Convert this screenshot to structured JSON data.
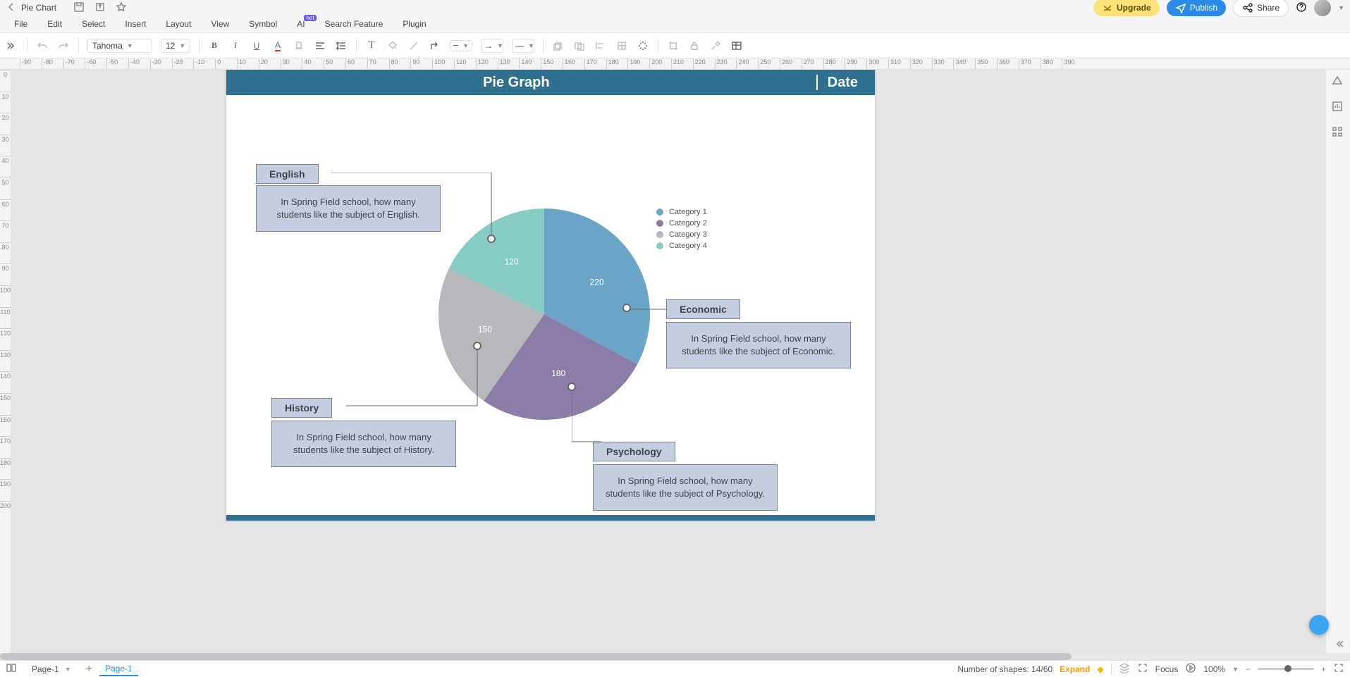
{
  "titlebar": {
    "doc_title": "Pie Chart",
    "upgrade": "Upgrade",
    "publish": "Publish",
    "share": "Share"
  },
  "menubar": [
    "File",
    "Edit",
    "Select",
    "Insert",
    "Layout",
    "View",
    "Symbol",
    "AI",
    "Search Feature",
    "Plugin"
  ],
  "menubar_hot": "hot",
  "toolbar": {
    "font": "Tahoma",
    "size": "12"
  },
  "canvas": {
    "header_title": "Pie Graph",
    "header_date": "Date"
  },
  "chart_data": {
    "type": "pie",
    "series": [
      {
        "label": "Category 1",
        "value": 220,
        "color": "#6aa5c8"
      },
      {
        "label": "Category 2",
        "value": 180,
        "color": "#8b7da8"
      },
      {
        "label": "Category 3",
        "value": 150,
        "color": "#b6b8bb"
      },
      {
        "label": "Category 4",
        "value": 120,
        "color": "#86ccc4"
      }
    ],
    "legend": [
      "Category 1",
      "Category 2",
      "Category 3",
      "Category 4"
    ]
  },
  "callouts": {
    "english": {
      "label": "English",
      "desc": "In Spring Field school, how many students like the subject of English."
    },
    "economic": {
      "label": "Economic",
      "desc": "In Spring Field school, how many students like the subject of Economic."
    },
    "history": {
      "label": "History",
      "desc": "In Spring Field school, how many students like the subject of History."
    },
    "psychology": {
      "label": "Psychology",
      "desc": "In Spring Field school, how many students like the subject of Psychology."
    }
  },
  "statusbar": {
    "page_dd": "Page-1",
    "page_tab": "Page-1",
    "shapes_label": "Number of shapes: ",
    "shapes_value": "14/60",
    "expand": "Expand",
    "focus": "Focus",
    "zoom": "100%"
  },
  "ruler_h": [
    "-90",
    "-80",
    "-70",
    "-60",
    "-50",
    "-40",
    "-30",
    "-20",
    "-10",
    "0",
    "10",
    "20",
    "30",
    "40",
    "50",
    "60",
    "70",
    "80",
    "90",
    "100",
    "110",
    "120",
    "130",
    "140",
    "150",
    "160",
    "170",
    "180",
    "190",
    "200",
    "210",
    "220",
    "230",
    "240",
    "250",
    "260",
    "270",
    "280",
    "290",
    "300",
    "310",
    "320",
    "330",
    "340",
    "350",
    "360",
    "370",
    "380",
    "390"
  ],
  "ruler_v": [
    "0",
    "10",
    "20",
    "30",
    "40",
    "50",
    "60",
    "70",
    "80",
    "90",
    "100",
    "110",
    "120",
    "130",
    "140",
    "150",
    "160",
    "170",
    "180",
    "190",
    "200"
  ]
}
